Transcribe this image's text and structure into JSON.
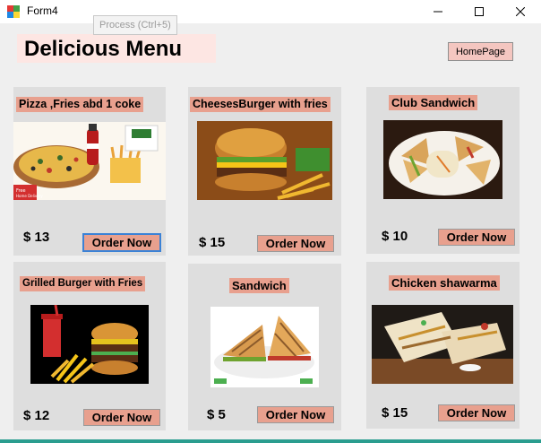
{
  "window": {
    "title": "Form4",
    "minimize_glyph": "—",
    "maximize_glyph": "☐",
    "close_glyph": "✕"
  },
  "tooltip": "Process (Ctrl+5)",
  "heading": "Delicious Menu",
  "home_button": "HomePage",
  "items": [
    {
      "title": "Pizza ,Fries abd 1 coke",
      "price": "$ 13",
      "order": "Order Now"
    },
    {
      "title": "CheesesBurger with fries",
      "price": "$ 15",
      "order": "Order Now"
    },
    {
      "title": "Club Sandwich",
      "price": "$ 10",
      "order": "Order Now"
    },
    {
      "title": "Grilled Burger with Fries",
      "price": "$ 12",
      "order": "Order Now"
    },
    {
      "title": "Sandwich",
      "price": "$ 5",
      "order": "Order Now"
    },
    {
      "title": "Chicken shawarma",
      "price": "$ 15",
      "order": "Order Now"
    }
  ],
  "image_text": {
    "free_home": "Free",
    "free_delivery": "Home Delivery"
  },
  "colors": {
    "card_bg": "#dedede",
    "label_bg": "#e8a08e",
    "heading_bg": "#fde6e3",
    "client_bg": "#efefef",
    "accent": "#2a9d8f"
  }
}
